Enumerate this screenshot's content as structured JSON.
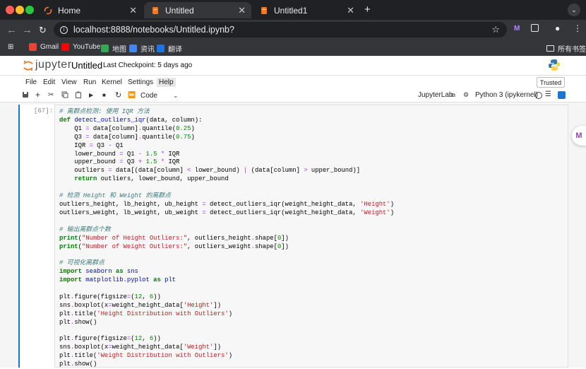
{
  "browser": {
    "tabs": [
      {
        "title": "Home",
        "active": false
      },
      {
        "title": "Untitled",
        "active": true
      },
      {
        "title": "Untitled1",
        "active": false
      }
    ],
    "new_tab": "+",
    "url": "localhost:8888/notebooks/Untitled.ipynb?",
    "bookmarks": [
      "Gmail",
      "YouTube",
      "地图",
      "资讯",
      "翻译"
    ],
    "all_bookmarks": "所有书签"
  },
  "jupyter": {
    "logo_text": "jupyter",
    "notebook_name": "Untitled",
    "checkpoint": "Last Checkpoint: 5 days ago",
    "menu": [
      "File",
      "Edit",
      "View",
      "Run",
      "Kernel",
      "Settings",
      "Help"
    ],
    "trusted": "Trusted",
    "cell_type": "Code",
    "jupyterlab_link": "JupyterLab",
    "kernel": "Python 3 (ipykernel)"
  },
  "cell": {
    "prompt": "[67]:"
  },
  "colors": {
    "accent": "#1976d2",
    "jupyter_orange": "#f37726"
  }
}
